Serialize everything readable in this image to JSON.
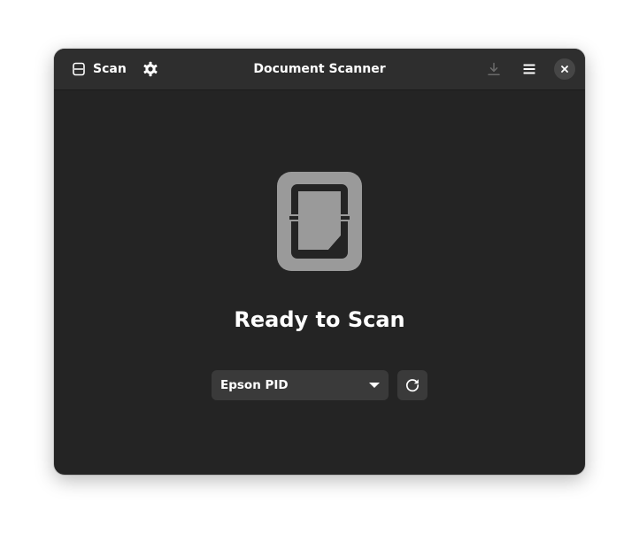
{
  "window": {
    "title": "Document Scanner"
  },
  "header": {
    "scan_label": "Scan",
    "icons": {
      "scan": "scanner-icon",
      "settings": "gear-icon",
      "save": "download-icon",
      "menu": "hamburger-menu-icon",
      "close": "close-icon"
    },
    "save_enabled": false
  },
  "status": {
    "icon": "scanner-document-icon",
    "title": "Ready to Scan"
  },
  "device": {
    "selected": "Epson PID",
    "dropdown_icon": "chevron-down-icon",
    "refresh_icon": "refresh-icon"
  },
  "colors": {
    "background": "#242424",
    "headerbar": "#2e2e2e",
    "button": "#3a3a3a",
    "text": "#ffffff",
    "icon_muted": "#9a9a9a"
  }
}
